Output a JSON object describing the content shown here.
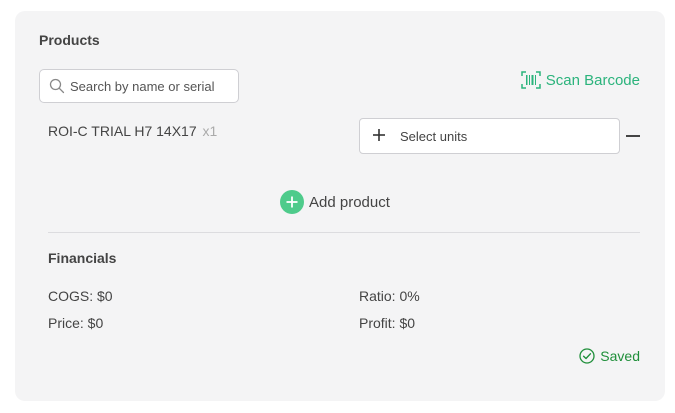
{
  "products": {
    "title": "Products",
    "search_placeholder": "Search by name or serial",
    "scan_label": "Scan Barcode",
    "item": {
      "name": "ROI-C TRIAL H7 14X17",
      "quantity": "x1",
      "select_units_label": "Select units"
    },
    "add_product_label": "Add product"
  },
  "financials": {
    "title": "Financials",
    "cogs": "COGS: $0",
    "price": "Price: $0",
    "ratio": "Ratio: 0%",
    "profit": "Profit: $0"
  },
  "status": {
    "saved_label": "Saved"
  },
  "colors": {
    "accent": "#2bb37c",
    "add_button": "#4ecb8b",
    "saved": "#1f8f3a",
    "card_bg": "#f4f4f5"
  },
  "icons": {
    "search": "search-icon",
    "scan": "barcode-icon",
    "add": "plus-circle-icon",
    "units_add": "plus-icon",
    "remove": "minus-icon",
    "saved": "check-circle-icon"
  }
}
